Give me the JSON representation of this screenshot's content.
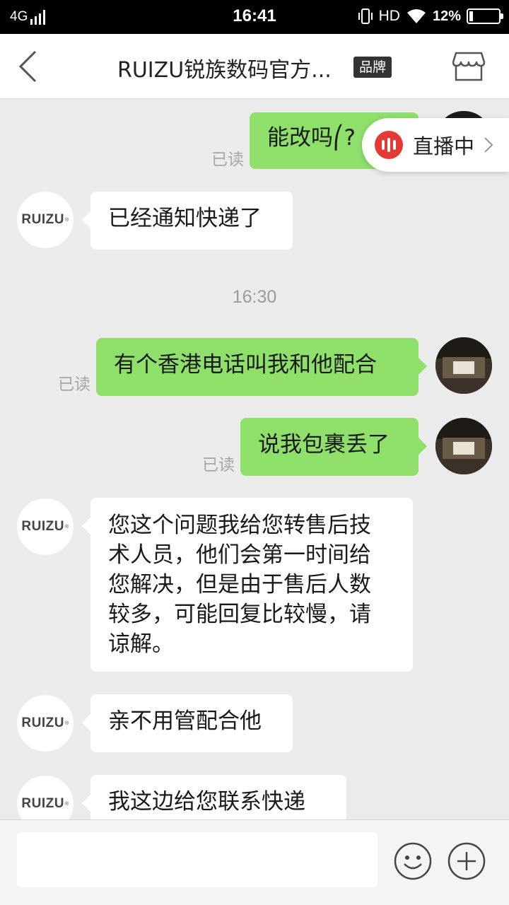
{
  "status_bar": {
    "network": "4G",
    "time": "16:41",
    "hd": "HD",
    "battery_text": "12%",
    "battery_level": 0.12,
    "signal_bars": 4
  },
  "header": {
    "title": "RUIZU锐族数码官方...",
    "badge": "品牌",
    "icons": {
      "back": "back-chevron-icon",
      "shop": "store-icon"
    }
  },
  "live_banner": {
    "label": "直播中",
    "icon": "live-audio-icon"
  },
  "shop_avatar": {
    "text": "RUIZU",
    "mark": "®"
  },
  "chat": {
    "read_label": "已读",
    "separator_time": "16:30",
    "messages": [
      {
        "from": "me",
        "text": "能改吗⎛?",
        "read": true
      },
      {
        "from": "shop",
        "text": "已经通知快递了"
      },
      {
        "from": "me",
        "text": "有个香港电话叫我和他配合",
        "read": true
      },
      {
        "from": "me",
        "text": "说我包裹丢了",
        "read": true
      },
      {
        "from": "shop",
        "lines": [
          "您这个问题我给您转售后技",
          "术人员，他们会第一时间给",
          "您解决，但是由于售后人数",
          "较多，可能回复比较慢，请",
          "谅解。"
        ]
      },
      {
        "from": "shop",
        "text": "亲不用管配合他"
      },
      {
        "from": "shop",
        "text": "我这边给您联系快递"
      }
    ]
  },
  "input_bar": {
    "placeholder": "",
    "icons": {
      "emoji": "emoji-icon",
      "plus": "plus-icon"
    }
  },
  "colors": {
    "outgoing_bubble": "#8ee06a",
    "incoming_bubble": "#ffffff",
    "live_red": "#e53935",
    "background": "#ebebeb"
  }
}
